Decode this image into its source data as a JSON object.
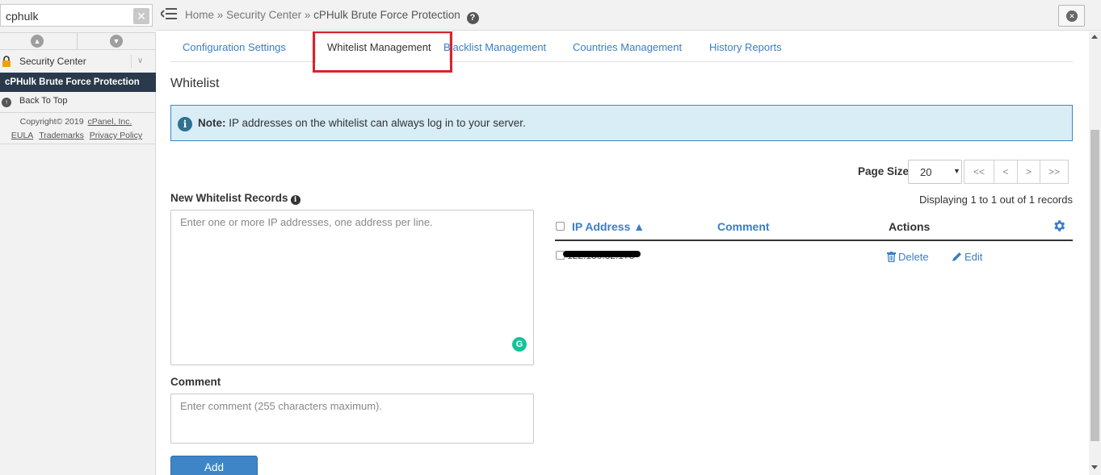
{
  "sidebar": {
    "search_value": "cphulk",
    "section_label": "Security Center",
    "active_item": "cPHulk Brute Force Protection",
    "back_to_top": "Back To Top",
    "copyright_prefix": "Copyright© 2019",
    "copyright_link": "cPanel, Inc.",
    "links": [
      "EULA",
      "Trademarks",
      "Privacy Policy"
    ]
  },
  "topbar": {
    "breadcrumb_home": "Home",
    "breadcrumb_sep": "»",
    "breadcrumb_section": "Security Center",
    "breadcrumb_current": "cPHulk Brute Force Protection",
    "help_glyph": "?"
  },
  "tabs": [
    {
      "label": "Configuration Settings",
      "active": false
    },
    {
      "label": "Whitelist Management",
      "active": true
    },
    {
      "label": "Blacklist Management",
      "active": false
    },
    {
      "label": "Countries Management",
      "active": false
    },
    {
      "label": "History Reports",
      "active": false
    }
  ],
  "page": {
    "title": "Whitelist",
    "note_label": "Note:",
    "note_text": "IP addresses on the whitelist can always log in to your server.",
    "new_records_label": "New Whitelist Records",
    "new_records_placeholder": "Enter one or more IP addresses, one address per line.",
    "comment_label": "Comment",
    "comment_placeholder": "Enter comment (255 characters maximum).",
    "add_label": "Add"
  },
  "pagination": {
    "page_size_label": "Page Size",
    "page_size_value": "20",
    "first": "<<",
    "prev": "<",
    "next": ">",
    "last": ">>",
    "displaying": "Displaying 1 to 1 out of 1 records"
  },
  "table": {
    "columns": {
      "ip": "IP Address ▲",
      "comment": "Comment",
      "actions": "Actions"
    },
    "rows": [
      {
        "ip": "122.180.32.173",
        "comment": "",
        "delete": "Delete",
        "edit": "Edit"
      }
    ]
  },
  "colors": {
    "link": "#3a7ec6",
    "highlight": "#d9232d",
    "note_bg": "#d9edf7",
    "button": "#3d85c6",
    "sidebar_active": "#2a3a4c"
  },
  "icons": {
    "search_clear": "close-icon",
    "lock": "lock-icon",
    "info": "info-icon",
    "gear": "gear-icon",
    "trash": "trash-icon",
    "pencil": "pencil-icon",
    "grammarly": "grammarly-icon"
  }
}
